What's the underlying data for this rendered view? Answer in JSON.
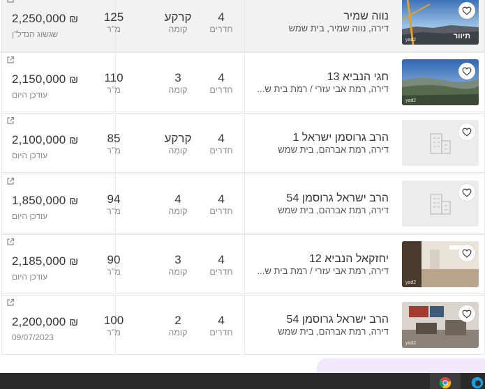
{
  "listings": [
    {
      "price": "2,250,000",
      "currency": "₪",
      "status": "שגשוג הנדל\"ן",
      "sqm": "125",
      "sqm_label": "מ\"ר",
      "floor": "קרקע",
      "floor_label": "קומה",
      "rooms": "4",
      "rooms_label": "חדרים",
      "title": "נווה שמיר",
      "subtitle": "דירה, נווה שמיר, בית שמש",
      "thumb": "landscape-city",
      "tour_badge": "תיוור",
      "watermark": "yad2",
      "highlighted": true
    },
    {
      "price": "2,150,000",
      "currency": "₪",
      "status": "עודכן היום",
      "sqm": "110",
      "sqm_label": "מ\"ר",
      "floor": "3",
      "floor_label": "קומה",
      "rooms": "4",
      "rooms_label": "חדרים",
      "title": "חגי הנביא 13",
      "subtitle": "דירה, רמת אבי עזרי / רמת בית ש...",
      "thumb": "landscape-hills",
      "watermark": "yad2",
      "highlighted": false
    },
    {
      "price": "2,100,000",
      "currency": "₪",
      "status": "עודכן היום",
      "sqm": "85",
      "sqm_label": "מ\"ר",
      "floor": "קרקע",
      "floor_label": "קומה",
      "rooms": "4",
      "rooms_label": "חדרים",
      "title": "הרב גרוסמן ישראל 1",
      "subtitle": "דירה, רמת אברהם, בית שמש",
      "thumb": "placeholder-building",
      "highlighted": false
    },
    {
      "price": "1,850,000",
      "currency": "₪",
      "status": "עודכן היום",
      "sqm": "94",
      "sqm_label": "מ\"ר",
      "floor": "4",
      "floor_label": "קומה",
      "rooms": "4",
      "rooms_label": "חדרים",
      "title": "הרב ישראל גרוסמן 54",
      "subtitle": "דירה, רמת אברהם, בית שמש",
      "thumb": "placeholder-building",
      "highlighted": false
    },
    {
      "price": "2,185,000",
      "currency": "₪",
      "status": "עודכן היום",
      "sqm": "90",
      "sqm_label": "מ\"ר",
      "floor": "3",
      "floor_label": "קומה",
      "rooms": "4",
      "rooms_label": "חדרים",
      "title": "יחזקאל הנביא 12",
      "subtitle": "דירה, רמת אבי עזרי / רמת בית ש...",
      "thumb": "interior-room",
      "watermark": "yad2",
      "highlighted": false
    },
    {
      "price": "2,200,000",
      "currency": "₪",
      "status": "09/07/2023",
      "sqm": "100",
      "sqm_label": "מ\"ר",
      "floor": "2",
      "floor_label": "קומה",
      "rooms": "4",
      "rooms_label": "חדרים",
      "title": "הרב ישראל גרוסמן 54",
      "subtitle": "דירה, רמת אברהם, בית שמש",
      "thumb": "interior-living",
      "watermark": "yad2",
      "highlighted": false
    }
  ],
  "icons": {
    "external_link": "external-link-icon",
    "favorite": "heart-icon",
    "placeholder": "building-icon"
  },
  "colors": {
    "text": "#363636",
    "muted": "#8a8a8a",
    "row_highlight": "#f2f2f2",
    "border": "#e6e6e6",
    "chat_bubble": "#f1e9fb",
    "taskbar": "#2b2b2b"
  }
}
